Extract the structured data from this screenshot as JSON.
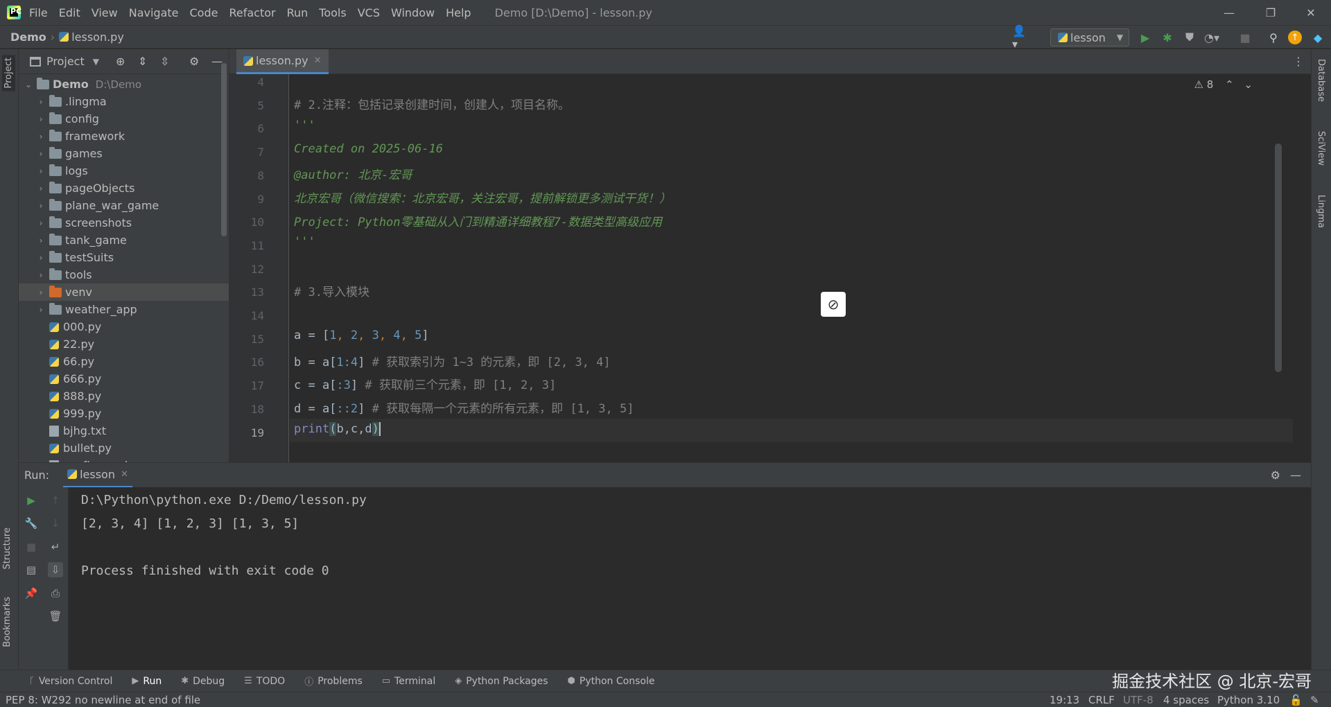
{
  "menu": [
    "File",
    "Edit",
    "View",
    "Navigate",
    "Code",
    "Refactor",
    "Run",
    "Tools",
    "VCS",
    "Window",
    "Help"
  ],
  "window_title": "Demo [D:\\Demo] - lesson.py",
  "breadcrumb": {
    "project": "Demo",
    "file": "lesson.py"
  },
  "run_config": "lesson",
  "project_panel": {
    "title": "Project",
    "root": {
      "name": "Demo",
      "path": "D:\\Demo"
    },
    "items": [
      {
        "name": ".lingma",
        "type": "folder"
      },
      {
        "name": "config",
        "type": "folder"
      },
      {
        "name": "framework",
        "type": "folder"
      },
      {
        "name": "games",
        "type": "folder"
      },
      {
        "name": "logs",
        "type": "folder"
      },
      {
        "name": "pageObjects",
        "type": "folder"
      },
      {
        "name": "plane_war_game",
        "type": "folder"
      },
      {
        "name": "screenshots",
        "type": "folder"
      },
      {
        "name": "tank_game",
        "type": "folder"
      },
      {
        "name": "testSuits",
        "type": "folder"
      },
      {
        "name": "tools",
        "type": "folder"
      },
      {
        "name": "venv",
        "type": "folder",
        "selected": true
      },
      {
        "name": "weather_app",
        "type": "folder"
      },
      {
        "name": "000.py",
        "type": "py"
      },
      {
        "name": "22.py",
        "type": "py"
      },
      {
        "name": "66.py",
        "type": "py"
      },
      {
        "name": "666.py",
        "type": "py"
      },
      {
        "name": "888.py",
        "type": "py"
      },
      {
        "name": "999.py",
        "type": "py"
      },
      {
        "name": "bjhg.txt",
        "type": "txt"
      },
      {
        "name": "bullet.py",
        "type": "py"
      },
      {
        "name": "config.yaml",
        "type": "txt"
      }
    ]
  },
  "editor": {
    "tab": "lesson.py",
    "warnings": "8",
    "line_numbers": [
      "4",
      "5",
      "6",
      "7",
      "8",
      "9",
      "10",
      "11",
      "12",
      "13",
      "14",
      "15",
      "16",
      "17",
      "18",
      "19"
    ],
    "lines": {
      "l5": "# 2.注释：包括记录创建时间，创建人，项目名称。",
      "l6": "'''",
      "l7": "Created on 2025-06-16",
      "l8": "@author: 北京-宏哥",
      "l9": "北京宏哥（微信搜索：北京宏哥，关注宏哥，提前解锁更多测试干货！）",
      "l10": "Project: Python零基础从入门到精通详细教程7-数据类型高级应用",
      "l11": "'''",
      "l13": "# 3.导入模块",
      "l15a": "a = [",
      "l15_nums": [
        "1",
        "2",
        "3",
        "4",
        "5"
      ],
      "l16_var": "b = a[",
      "l16_slice": "1:4",
      "l16_comment": "# 获取索引为 1~3 的元素，即 [2, 3, 4]",
      "l17_var": "c = a[",
      "l17_slice": ":3",
      "l17_comment": "# 获取前三个元素，即 [1, 2, 3]",
      "l18_var": "d = a[",
      "l18_slice": "::2",
      "l18_comment": "# 获取每隔一个元素的所有元素，即 [1, 3, 5]",
      "l19_func": "print",
      "l19_args": "b,c,d"
    }
  },
  "run_panel": {
    "label": "Run:",
    "tab": "lesson",
    "console": [
      "D:\\Python\\python.exe D:/Demo/lesson.py",
      "[2, 3, 4] [1, 2, 3] [1, 3, 5]",
      "",
      "Process finished with exit code 0"
    ]
  },
  "tool_tabs": [
    "Version Control",
    "Run",
    "Debug",
    "TODO",
    "Problems",
    "Terminal",
    "Python Packages",
    "Python Console"
  ],
  "watermark": "掘金技术社区 @ 北京-宏哥",
  "status": {
    "message": "PEP 8: W292 no newline at end of file",
    "position": "19:13",
    "line_sep": "CRLF",
    "encoding": "UTF-8",
    "indent": "4 spaces",
    "interpreter": "Python 3.10"
  },
  "side_tabs": {
    "left_top": "Project",
    "left_structure": "Structure",
    "left_bookmarks": "Bookmarks",
    "right": [
      "Database",
      "SciView",
      "Lingma"
    ]
  }
}
